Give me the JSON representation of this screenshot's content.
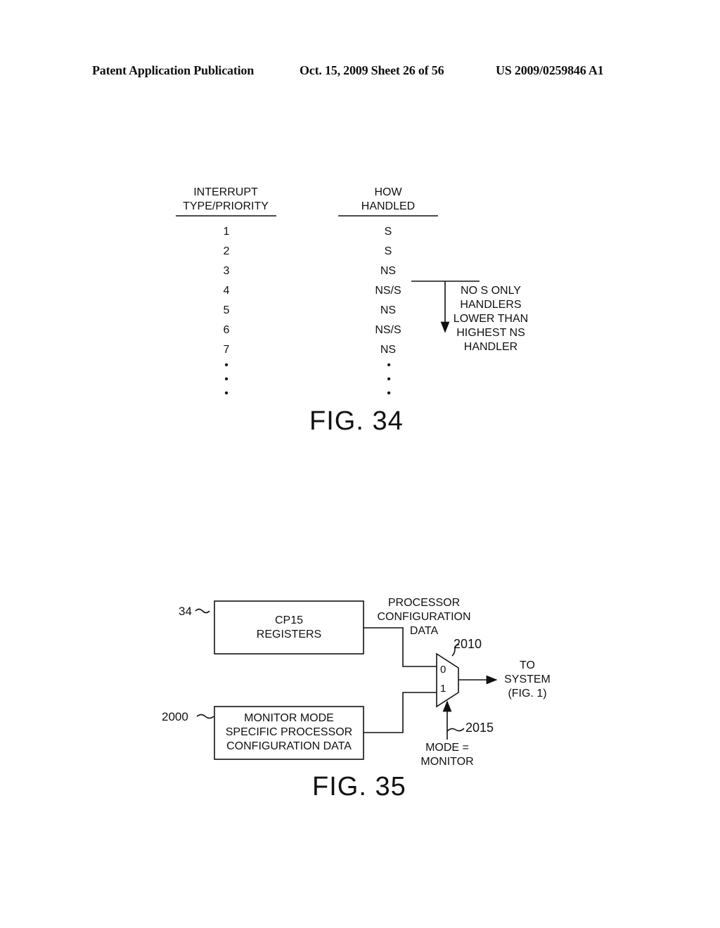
{
  "header": {
    "left": "Patent Application Publication",
    "date_sheet": "Oct. 15, 2009   Sheet 26 of 56",
    "number": "US 2009/0259846 A1"
  },
  "fig34": {
    "col1_header": [
      "INTERRUPT",
      "TYPE/PRIORITY"
    ],
    "col2_header": [
      "HOW",
      "HANDLED"
    ],
    "rows": [
      {
        "priority": "1",
        "handled": "S"
      },
      {
        "priority": "2",
        "handled": "S"
      },
      {
        "priority": "3",
        "handled": "NS"
      },
      {
        "priority": "4",
        "handled": "NS/S"
      },
      {
        "priority": "5",
        "handled": "NS"
      },
      {
        "priority": "6",
        "handled": "NS/S"
      },
      {
        "priority": "7",
        "handled": "NS"
      }
    ],
    "ellipsis": "•",
    "annotation": [
      "NO S ONLY",
      "HANDLERS",
      "LOWER THAN",
      "HIGHEST NS",
      "HANDLER"
    ],
    "caption": "FIG. 34"
  },
  "fig35": {
    "block1": {
      "ref": "34",
      "label": [
        "CP15",
        "REGISTERS"
      ]
    },
    "block2": {
      "ref": "2000",
      "label": [
        "MONITOR MODE",
        "SPECIFIC PROCESSOR",
        "CONFIGURATION DATA"
      ]
    },
    "signal_label": [
      "PROCESSOR",
      "CONFIGURATION",
      "DATA"
    ],
    "mux": {
      "ref": "2010",
      "input0": "0",
      "input1": "1"
    },
    "output_label": [
      "TO",
      "SYSTEM",
      "(FIG. 1)"
    ],
    "select": {
      "ref": "2015",
      "label": [
        "MODE =",
        "MONITOR"
      ]
    },
    "caption": "FIG. 35"
  }
}
